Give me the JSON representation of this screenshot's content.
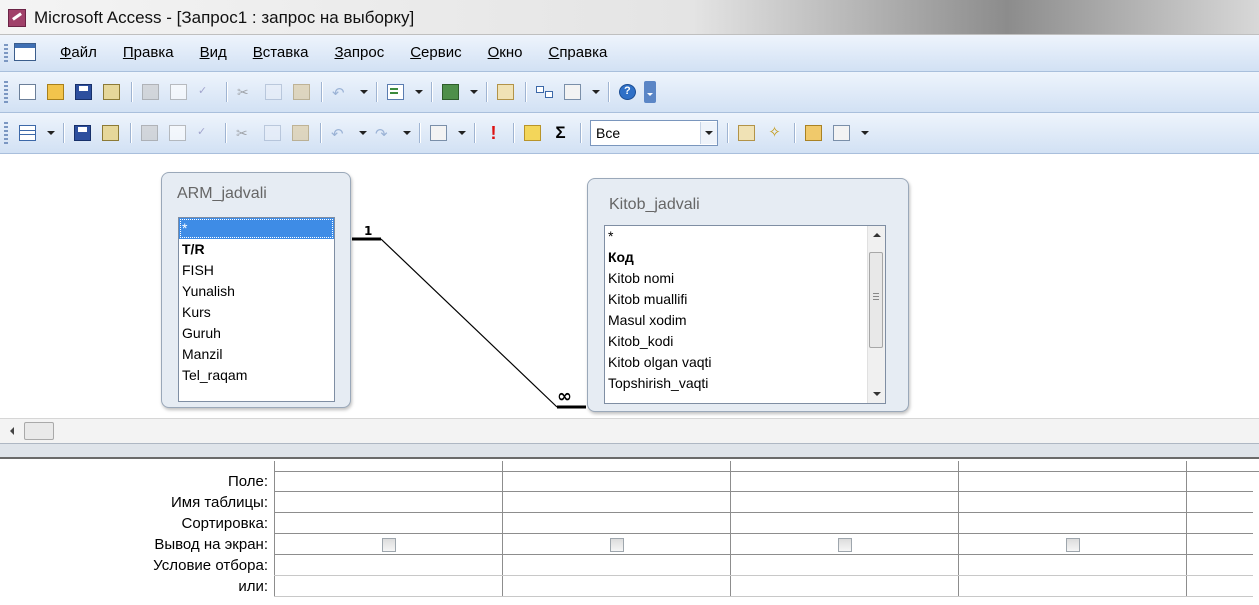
{
  "window": {
    "title": "Microsoft Access - [Запрос1 : запрос на выборку]"
  },
  "menu": {
    "items": [
      "Файл",
      "Правка",
      "Вид",
      "Вставка",
      "Запрос",
      "Сервис",
      "Окно",
      "Справка"
    ]
  },
  "toolbar_query": {
    "top_values": "Все"
  },
  "tables": {
    "left": {
      "name": "ARM_jadvali",
      "fields": [
        "*",
        "T/R",
        "FISH",
        "Yunalish",
        "Kurs",
        "Guruh",
        "Manzil",
        "Tel_raqam"
      ]
    },
    "right": {
      "name": "Kitob_jadvali",
      "fields": [
        "*",
        "Код",
        "Kitob nomi",
        "Kitob muallifi",
        "Masul xodim",
        "Kitob_kodi",
        "Kitob olgan vaqti",
        "Topshirish_vaqti"
      ]
    }
  },
  "relationship": {
    "one_side": "1",
    "many_side": "∞"
  },
  "grid": {
    "rows": [
      "Поле:",
      "Имя таблицы:",
      "Сортировка:",
      "Вывод на экран:",
      "Условие отбора:",
      "или:"
    ]
  }
}
